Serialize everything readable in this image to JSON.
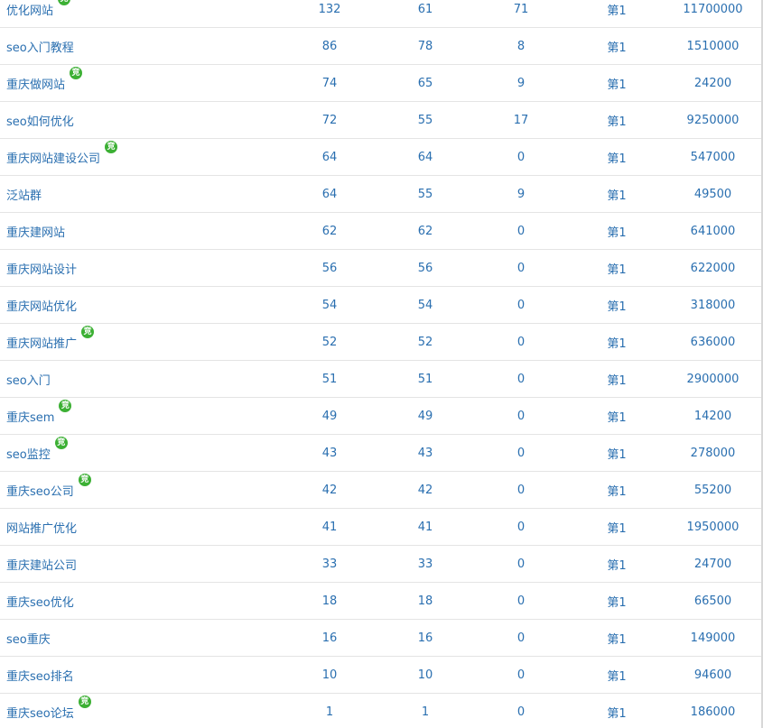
{
  "badge_text": "竞",
  "colors": {
    "link": "#2a6fb0",
    "badge": "#3cb034",
    "row_border": "#e4e4e4"
  },
  "rows": [
    {
      "keyword": "优化网站",
      "badge": true,
      "c1": "132",
      "c2": "61",
      "c3": "71",
      "rank": "第1",
      "volume": "11700000"
    },
    {
      "keyword": "seo入门教程",
      "badge": false,
      "c1": "86",
      "c2": "78",
      "c3": "8",
      "rank": "第1",
      "volume": "1510000"
    },
    {
      "keyword": "重庆做网站",
      "badge": true,
      "c1": "74",
      "c2": "65",
      "c3": "9",
      "rank": "第1",
      "volume": "24200"
    },
    {
      "keyword": "seo如何优化",
      "badge": false,
      "c1": "72",
      "c2": "55",
      "c3": "17",
      "rank": "第1",
      "volume": "9250000"
    },
    {
      "keyword": "重庆网站建设公司",
      "badge": true,
      "c1": "64",
      "c2": "64",
      "c3": "0",
      "rank": "第1",
      "volume": "547000"
    },
    {
      "keyword": "泛站群",
      "badge": false,
      "c1": "64",
      "c2": "55",
      "c3": "9",
      "rank": "第1",
      "volume": "49500"
    },
    {
      "keyword": "重庆建网站",
      "badge": false,
      "c1": "62",
      "c2": "62",
      "c3": "0",
      "rank": "第1",
      "volume": "641000"
    },
    {
      "keyword": "重庆网站设计",
      "badge": false,
      "c1": "56",
      "c2": "56",
      "c3": "0",
      "rank": "第1",
      "volume": "622000"
    },
    {
      "keyword": "重庆网站优化",
      "badge": false,
      "c1": "54",
      "c2": "54",
      "c3": "0",
      "rank": "第1",
      "volume": "318000"
    },
    {
      "keyword": "重庆网站推广",
      "badge": true,
      "c1": "52",
      "c2": "52",
      "c3": "0",
      "rank": "第1",
      "volume": "636000"
    },
    {
      "keyword": "seo入门",
      "badge": false,
      "c1": "51",
      "c2": "51",
      "c3": "0",
      "rank": "第1",
      "volume": "2900000"
    },
    {
      "keyword": "重庆sem",
      "badge": true,
      "c1": "49",
      "c2": "49",
      "c3": "0",
      "rank": "第1",
      "volume": "14200"
    },
    {
      "keyword": "seo监控",
      "badge": true,
      "c1": "43",
      "c2": "43",
      "c3": "0",
      "rank": "第1",
      "volume": "278000"
    },
    {
      "keyword": "重庆seo公司",
      "badge": true,
      "c1": "42",
      "c2": "42",
      "c3": "0",
      "rank": "第1",
      "volume": "55200"
    },
    {
      "keyword": "网站推广优化",
      "badge": false,
      "c1": "41",
      "c2": "41",
      "c3": "0",
      "rank": "第1",
      "volume": "1950000"
    },
    {
      "keyword": "重庆建站公司",
      "badge": false,
      "c1": "33",
      "c2": "33",
      "c3": "0",
      "rank": "第1",
      "volume": "24700"
    },
    {
      "keyword": "重庆seo优化",
      "badge": false,
      "c1": "18",
      "c2": "18",
      "c3": "0",
      "rank": "第1",
      "volume": "66500"
    },
    {
      "keyword": "seo重庆",
      "badge": false,
      "c1": "16",
      "c2": "16",
      "c3": "0",
      "rank": "第1",
      "volume": "149000"
    },
    {
      "keyword": "重庆seo排名",
      "badge": false,
      "c1": "10",
      "c2": "10",
      "c3": "0",
      "rank": "第1",
      "volume": "94600"
    },
    {
      "keyword": "重庆seo论坛",
      "badge": true,
      "c1": "1",
      "c2": "1",
      "c3": "0",
      "rank": "第1",
      "volume": "186000"
    }
  ]
}
